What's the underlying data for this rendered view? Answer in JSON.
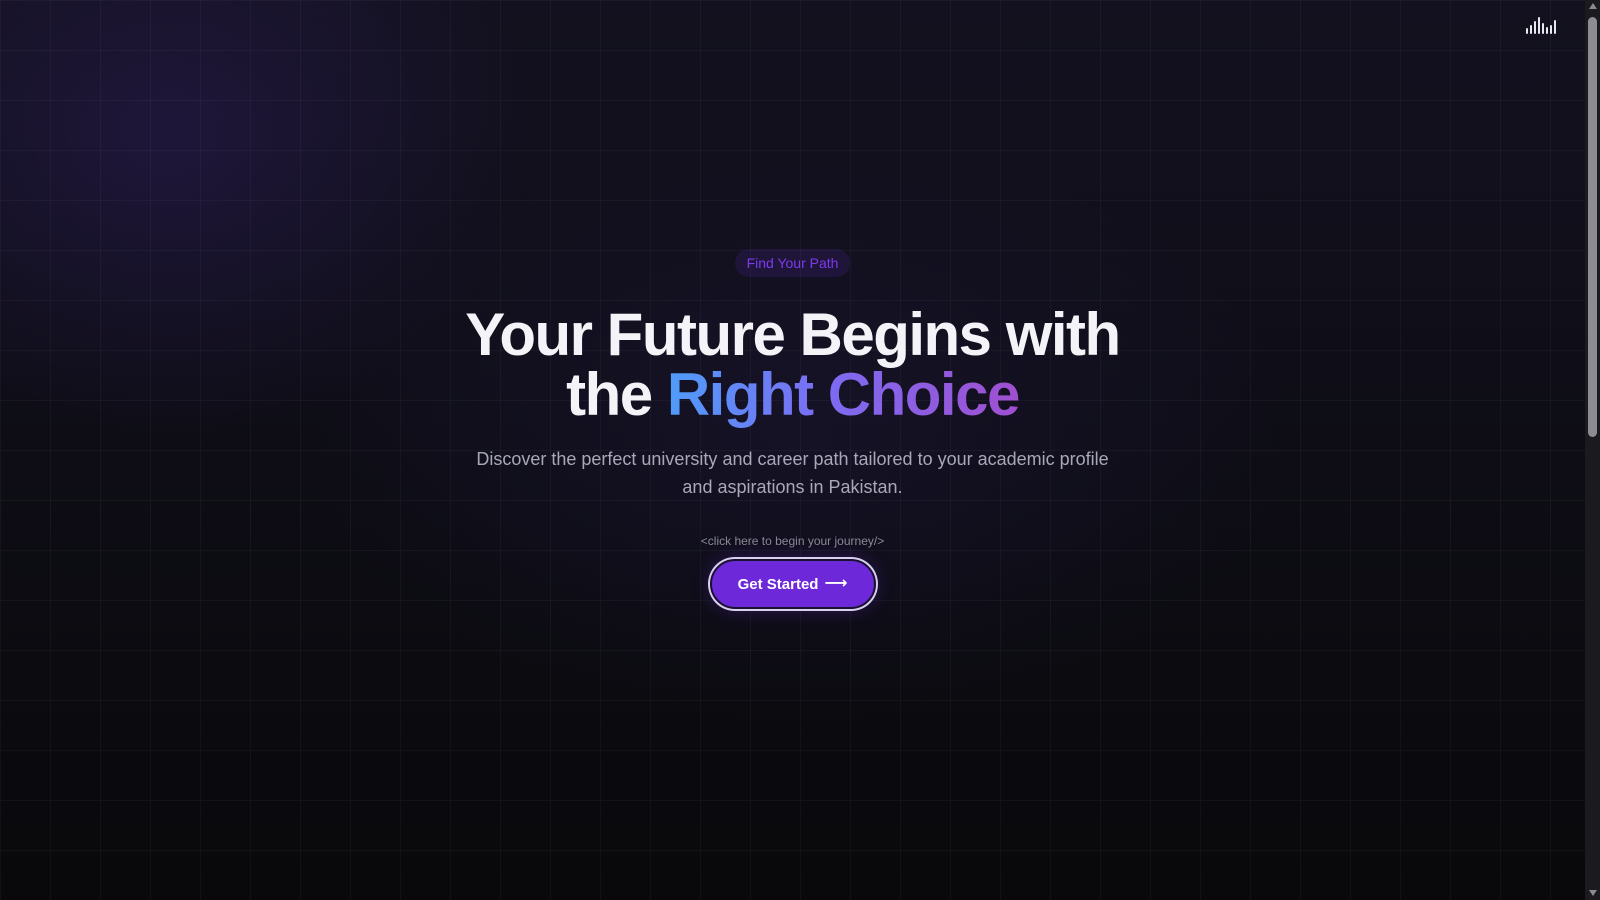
{
  "header": {
    "menu_icon": "audio-bars-icon"
  },
  "hero": {
    "badge": "Find Your Path",
    "headline_line1": "Your Future Begins with",
    "headline_line2_prefix": "the",
    "headline_accent": "Right Choice",
    "subtitle": "Discover the perfect university and career path tailored to your academic profile and aspirations in Pakistan.",
    "hint": "<click here to begin your journey/>",
    "cta_label": "Get Started",
    "cta_icon": "arrow-right-icon"
  },
  "colors": {
    "accent": "#6d28d9",
    "badge_text": "#7c3aed",
    "gradient_start": "#4f9cf9",
    "gradient_end": "#a04fd0",
    "background": "#0b0b10"
  }
}
